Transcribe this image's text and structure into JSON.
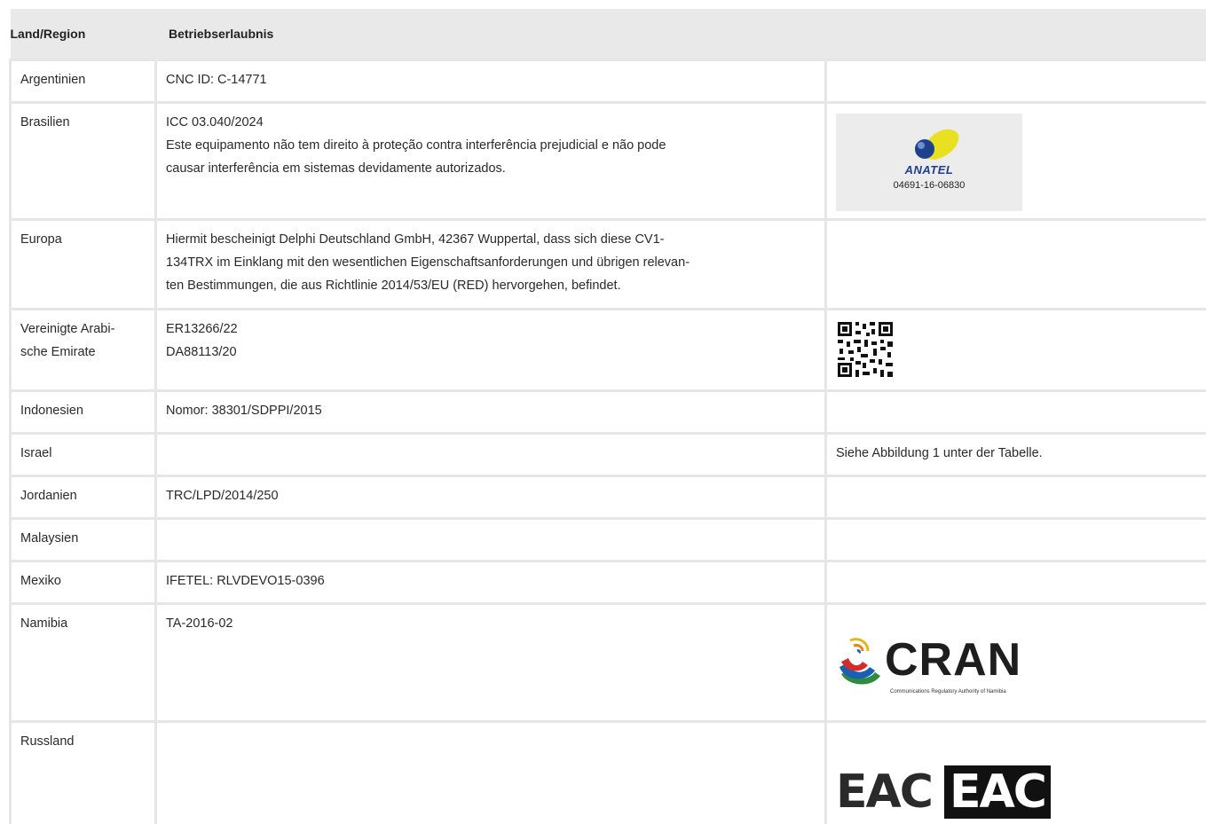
{
  "header": {
    "col1": "Land/Region",
    "col2": "Betriebserlaubnis"
  },
  "rows": [
    {
      "country": "Argentinien",
      "lines": [
        "CNC ID: C-14771"
      ],
      "note": ""
    },
    {
      "country": "Brasilien",
      "lines": [
        "ICC 03.040/2024",
        "Este equipamento não tem direito à proteção contra interferência prejudicial e não pode",
        "causar interferência em sistemas devidamente autorizados."
      ],
      "note": ""
    },
    {
      "country": "Europa",
      "lines": [
        "Hiermit bescheinigt Delphi Deutschland GmbH, 42367 Wuppertal, dass sich diese CV1-",
        "134TRX im Einklang mit den wesentlichen Eigenschaftsanforderungen und übrigen relevan-",
        "ten Bestimmungen, die aus Richtlinie 2014/53/EU (RED) hervorgehen, befindet."
      ],
      "note": ""
    },
    {
      "country_lines": [
        "Vereinigte Arabi-",
        "sche Emirate"
      ],
      "lines": [
        "ER13266/22",
        "DA88113/20"
      ],
      "note": ""
    },
    {
      "country": "Indonesien",
      "lines": [
        "Nomor: 38301/SDPPI/2015"
      ],
      "note": ""
    },
    {
      "country": "Israel",
      "lines": [],
      "note": "Siehe Abbildung 1 unter der Tabelle."
    },
    {
      "country": "Jordanien",
      "lines": [
        "TRC/LPD/2014/250"
      ],
      "note": ""
    },
    {
      "country": "Malaysien",
      "lines": [],
      "note": ""
    },
    {
      "country": "Mexiko",
      "lines": [
        "IFETEL: RLVDEVO15-0396"
      ],
      "note": ""
    },
    {
      "country": "Namibia",
      "lines": [
        "TA-2016-02"
      ],
      "note": ""
    },
    {
      "country": "Russland",
      "lines": [],
      "note": ""
    }
  ],
  "logos": {
    "anatel": {
      "name": "ANATEL",
      "number": "04691-16-06830",
      "icon": "anatel-logo"
    },
    "qr": {
      "icon": "qr-code-icon"
    },
    "cran": {
      "name": "CRAN",
      "subtitle": "Communications Regulatory Authority of Namibia",
      "icon": "cran-logo"
    },
    "eac": {
      "text": "EAC",
      "icon": "eac-mark"
    },
    "colors": {
      "anatel_yellow": "#e8e020",
      "anatel_blue": "#1f3f8f",
      "header_bg": "#e9e9e9",
      "border": "#e6e6e6"
    }
  }
}
